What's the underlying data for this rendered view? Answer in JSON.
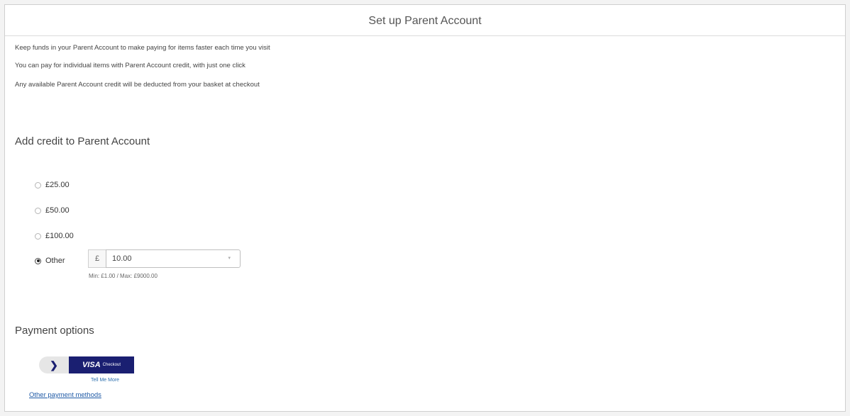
{
  "page": {
    "title": "Set up Parent Account"
  },
  "info": {
    "line1": "Keep funds in your Parent Account to make paying for items faster each time you visit",
    "line2": "You can pay for individual items with Parent Account credit, with just one click",
    "line3": "Any available Parent Account credit will be deducted from your basket at checkout"
  },
  "credit": {
    "heading": "Add credit to Parent Account",
    "options": [
      {
        "label": "£25.00",
        "selected": false
      },
      {
        "label": "£50.00",
        "selected": false
      },
      {
        "label": "£100.00",
        "selected": false
      },
      {
        "label": "Other",
        "selected": true
      }
    ],
    "currency_symbol": "£",
    "other_amount": "10.00",
    "spin_icon": "▾",
    "min_max_hint": "Min: £1.00 / Max: £9000.00"
  },
  "payment": {
    "heading": "Payment options",
    "arrow_icon": "❯",
    "visa_label": "VISA",
    "visa_sub": "Checkout",
    "tell_me_more": "Tell Me More",
    "other_methods": "Other payment methods"
  },
  "colors": {
    "visa_blue": "#1a1f71",
    "link_blue": "#1f5aa6"
  }
}
